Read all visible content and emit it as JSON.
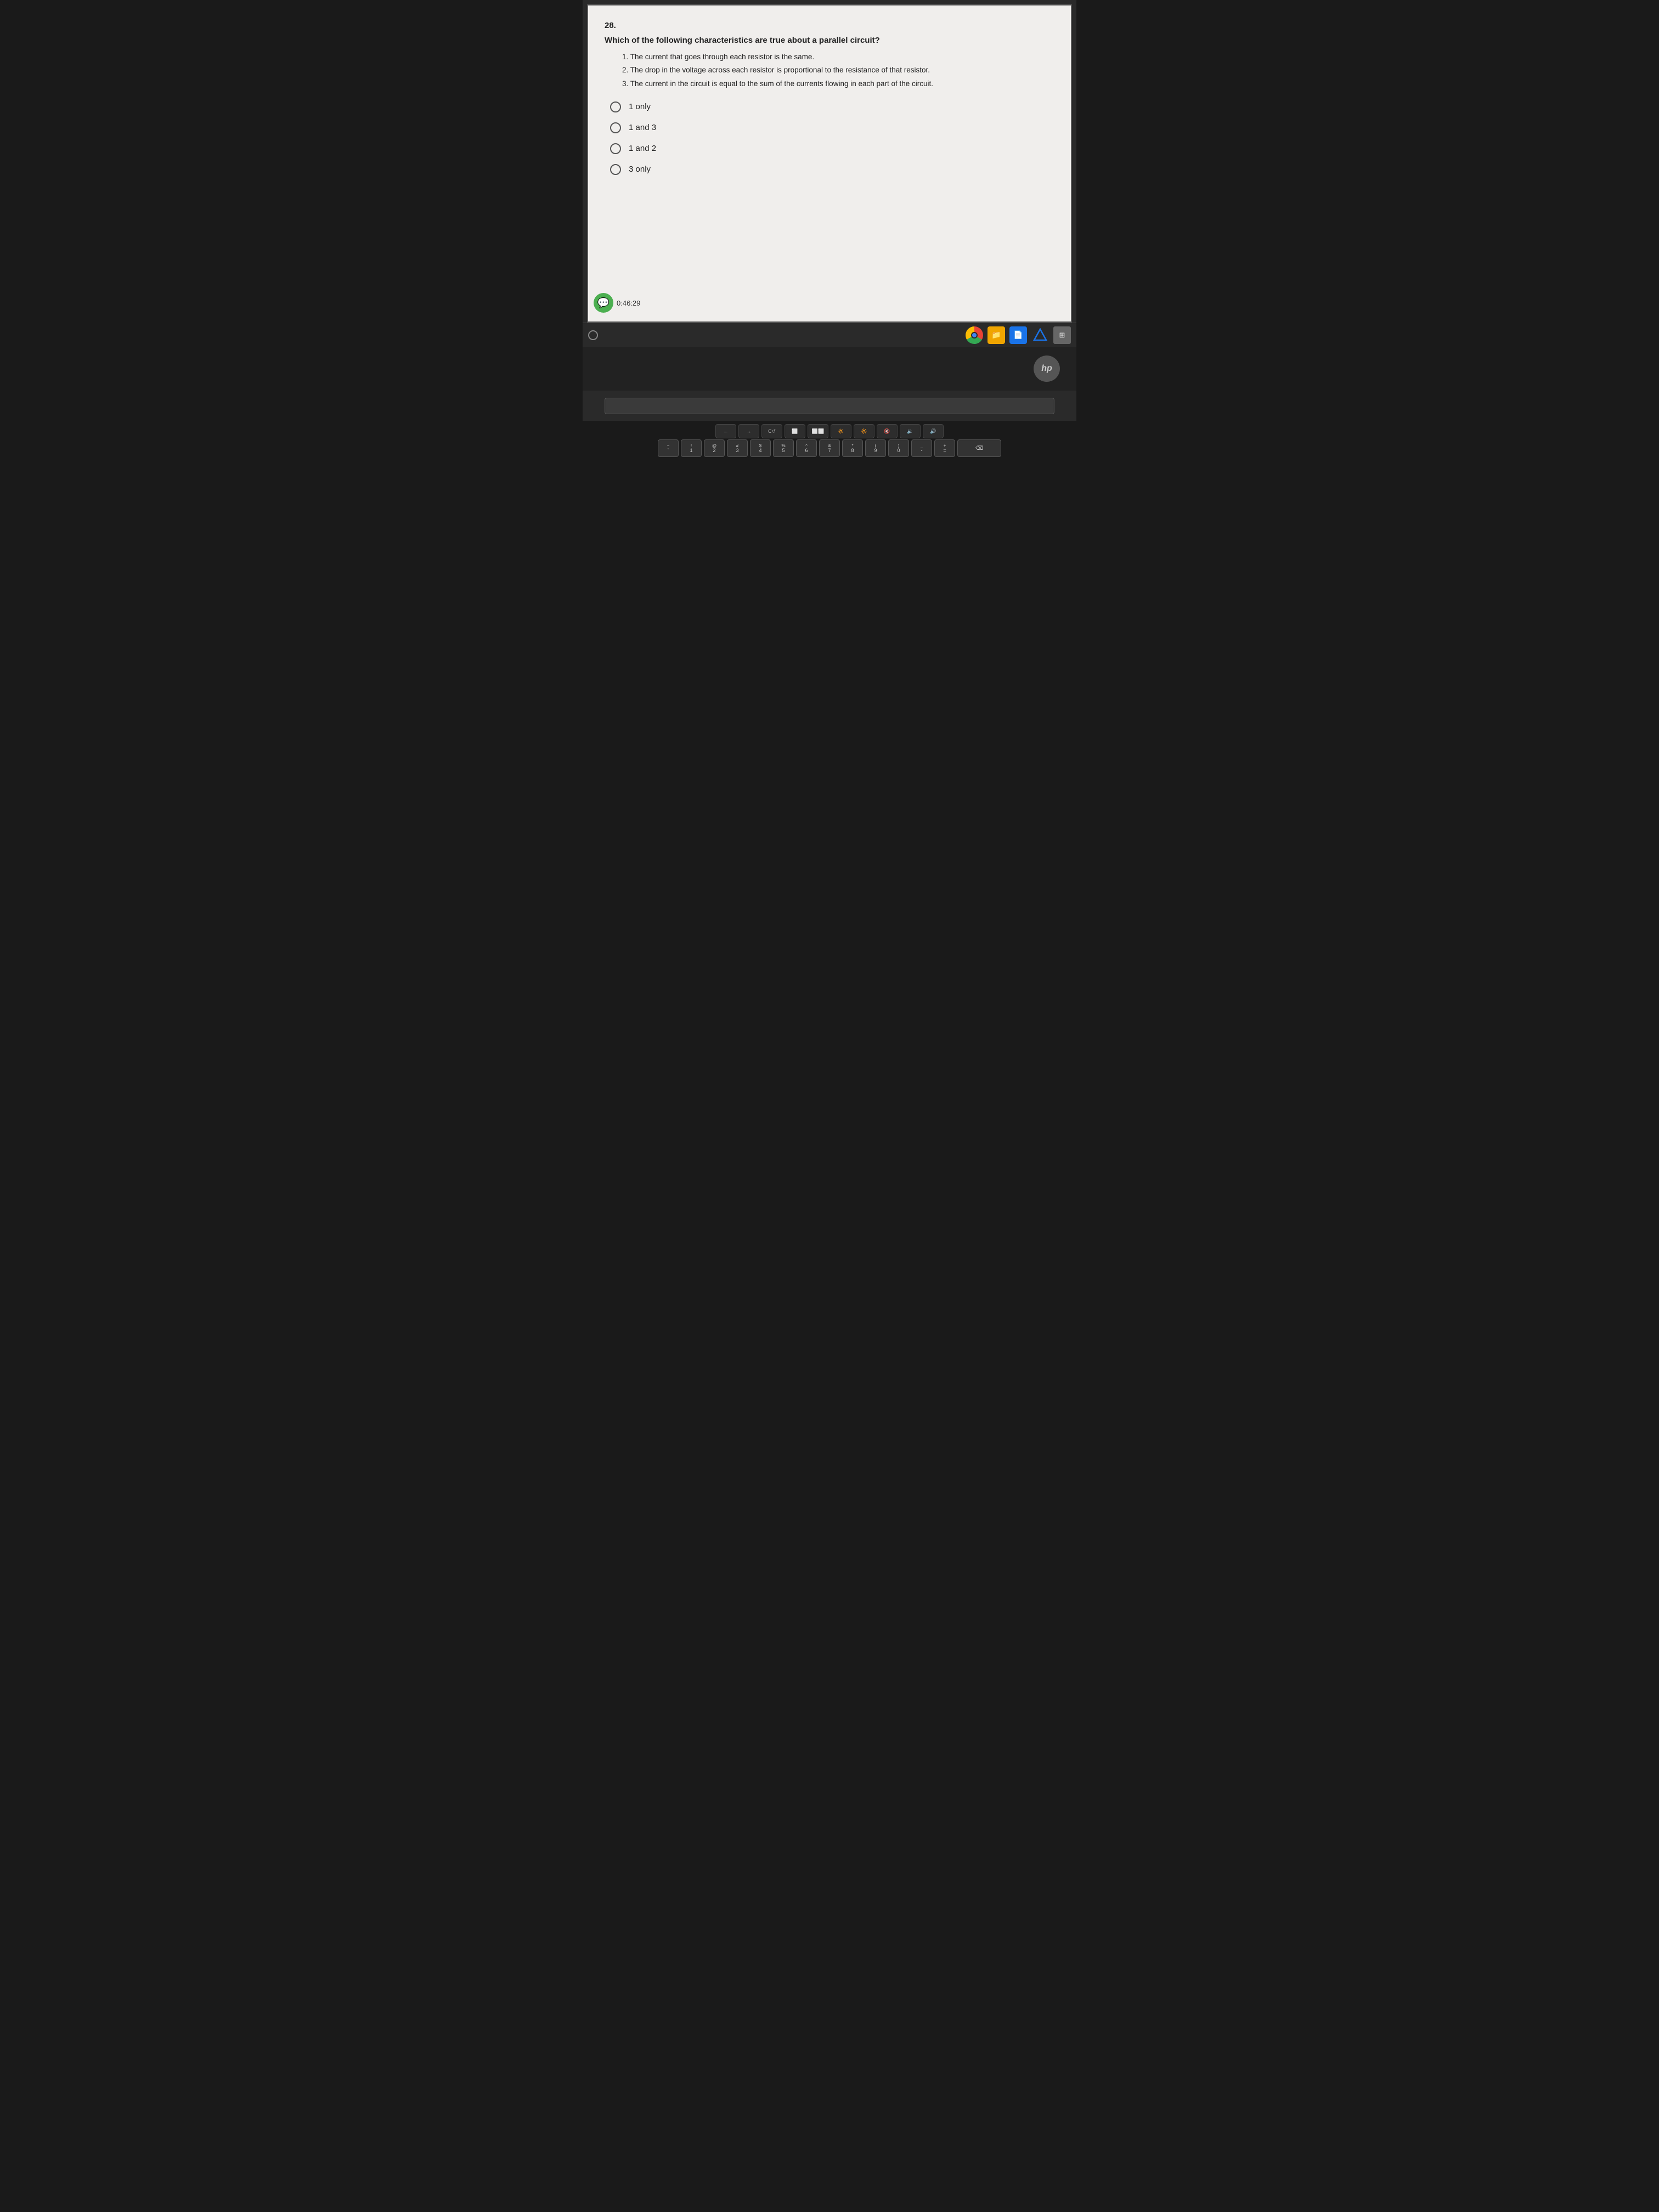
{
  "question": {
    "number": "28.",
    "text": "Which of the following characteristics are true about a parallel circuit?",
    "statements": [
      "1. The current that goes through each resistor is the same.",
      "2. The drop in the voltage across each resistor is proportional to the resistance of that resistor.",
      "3. The current in the circuit is equal to the sum of the currents flowing in each part of the circuit."
    ],
    "options": [
      {
        "id": "opt1",
        "label": "1 only"
      },
      {
        "id": "opt2",
        "label": "1 and 3"
      },
      {
        "id": "opt3",
        "label": "1 and 2"
      },
      {
        "id": "opt4",
        "label": "3 only"
      }
    ]
  },
  "timer": {
    "display": "0:46:29"
  },
  "taskbar": {
    "icons": [
      "chrome",
      "files",
      "docs",
      "drive",
      "grid"
    ]
  },
  "keyboard": {
    "row1": [
      "←",
      "→",
      "C↺",
      "⬜",
      "⬜⬜",
      ""
    ],
    "row2_labels": [
      "!",
      "1",
      "@",
      "2",
      "#",
      "3",
      "$",
      "4",
      "%",
      "5",
      "^",
      "6",
      "&",
      "7"
    ],
    "row_number_keys": [
      {
        "top": "!",
        "bot": "1"
      },
      {
        "top": "@",
        "bot": "2"
      },
      {
        "top": "#",
        "bot": "3"
      },
      {
        "top": "$",
        "bot": "4"
      },
      {
        "top": "%",
        "bot": "5"
      },
      {
        "top": "^",
        "bot": "6"
      },
      {
        "top": "&",
        "bot": "7"
      }
    ]
  },
  "hp_logo": "hp"
}
